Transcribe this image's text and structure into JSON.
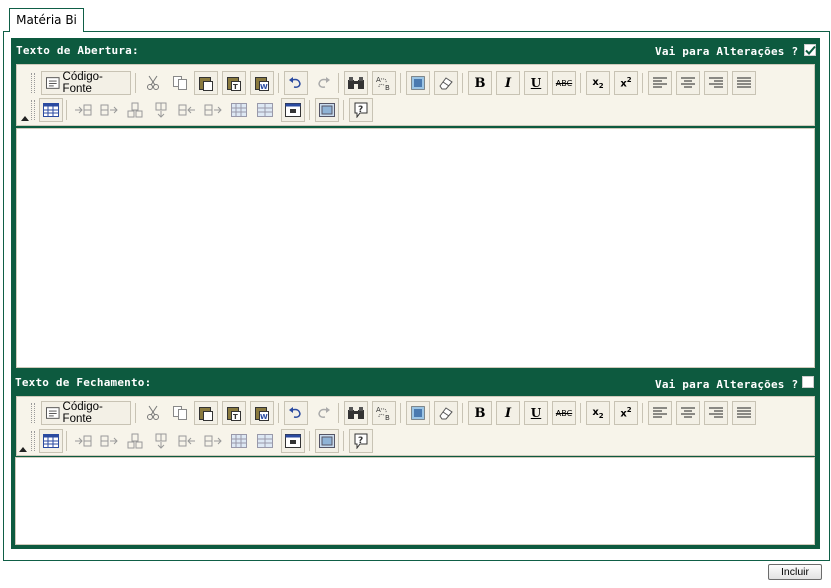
{
  "tab": {
    "label": "Matéria Bi"
  },
  "sections": [
    {
      "title": "Texto de Abertura:",
      "vai_label": "Vai para Alterações ?",
      "vai_checked": true,
      "editor_content": ""
    },
    {
      "title": "Texto de Fechamento:",
      "vai_label": "Vai para Alterações ?",
      "vai_checked": false,
      "editor_content": ""
    }
  ],
  "toolbar": {
    "source_label": "Código-Fonte",
    "row1": [
      "cut",
      "copy",
      "paste",
      "paste-text",
      "paste-word",
      "undo",
      "redo",
      "find",
      "replace",
      "select-all",
      "remove-format",
      "bold",
      "italic",
      "underline",
      "strikethrough",
      "subscript",
      "superscript",
      "align-left",
      "align-center",
      "align-right",
      "align-justify"
    ],
    "row2": [
      "table",
      "insert-row-before",
      "insert-row-after",
      "delete-row",
      "insert-column-before",
      "insert-column-after",
      "delete-column",
      "merge-cells",
      "split-cell",
      "special-char",
      "image",
      "help"
    ]
  },
  "actions": {
    "submit_label": "Incluir"
  },
  "colors": {
    "header": "#0d5a3f",
    "toolbar": "#f7f4ea",
    "border": "#cfcabb"
  }
}
